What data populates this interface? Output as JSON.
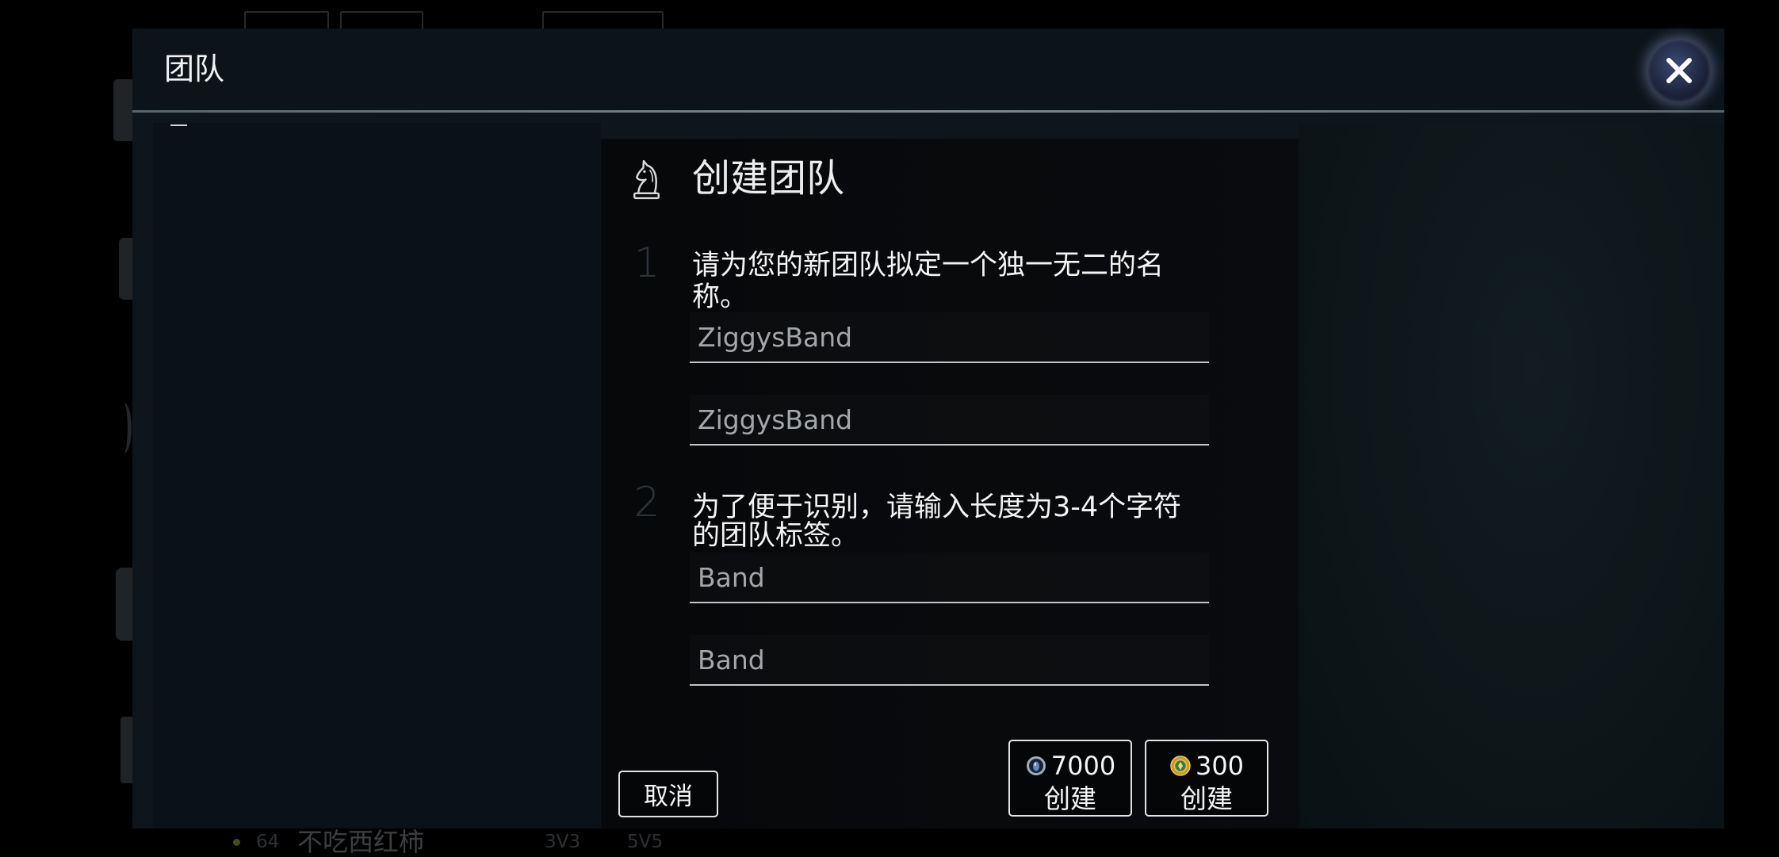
{
  "window": {
    "title": "团队"
  },
  "background": {
    "player_row": {
      "level": "64",
      "name": "不吃西红柿",
      "mode_a": "3V3",
      "mode_b": "5V5"
    }
  },
  "create_team": {
    "title": "创建团队",
    "steps": [
      {
        "number": "1",
        "instruction_lines": [
          "请为您的新团队拟定一个独一无二的名",
          "称。"
        ],
        "fields": [
          "ZiggysBand",
          "ZiggysBand"
        ]
      },
      {
        "number": "2",
        "instruction_lines": [
          "为了便于识别，请输入长度为3-4个字符",
          "的团队标签。"
        ],
        "fields": [
          "Band",
          "Band"
        ]
      }
    ],
    "cancel_label": "取消",
    "create_options": [
      {
        "price": "7000",
        "label": "创建",
        "currency_icon": "blue-essence-icon"
      },
      {
        "price": "300",
        "label": "创建",
        "currency_icon": "gold-coin-icon"
      }
    ]
  },
  "icons": {
    "close": "close-icon",
    "team": "chess-knight-icon"
  },
  "colors": {
    "modal_bg": "#0e161b",
    "card_bg": "#08090b",
    "text": "#f3f3f3",
    "field_text": "#a4a7aa",
    "field_underline": "#c2c5c8",
    "button_border": "#e4e4e4",
    "step_number": "#2e3439"
  }
}
